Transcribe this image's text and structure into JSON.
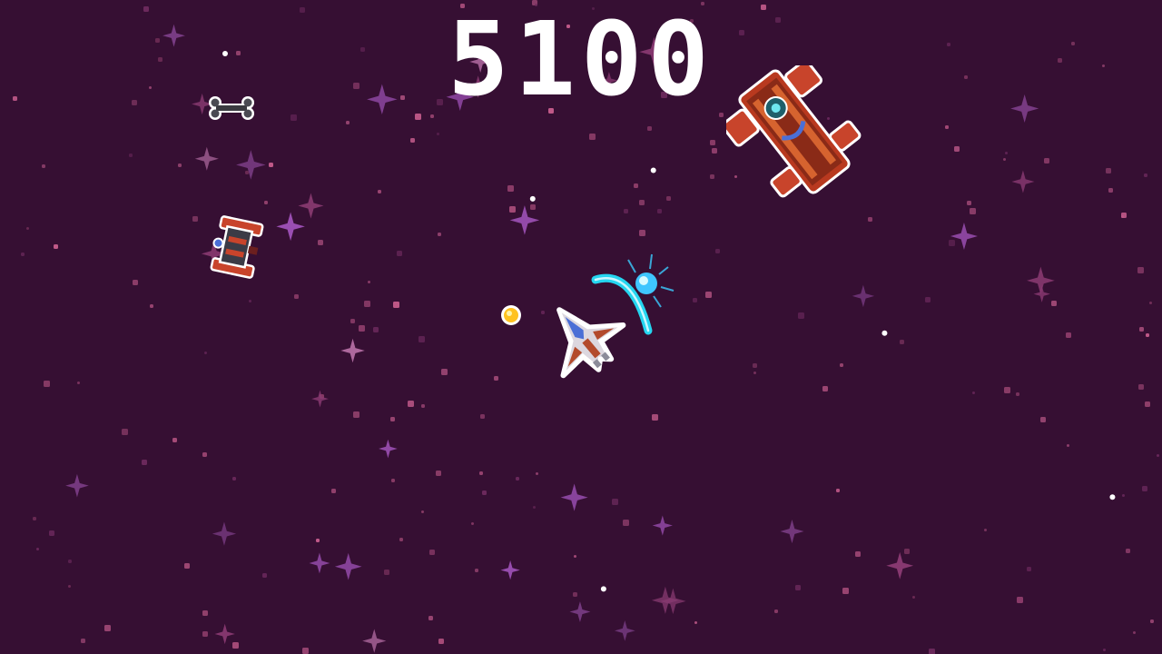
{
  "hud": {
    "score": "5100"
  },
  "colors": {
    "background": "#360f33",
    "star_dot": "#a24a78",
    "star_sparkle": "#7b3d86",
    "player_hull": "#e8e4ea",
    "player_accent": "#b34a2c",
    "enemy_hull": "#c8442b",
    "enemy_dark": "#6b1f1f",
    "shield_arc": "#25d6f0",
    "enemy_bullet": "#ffc21f",
    "outline": "#ffffff"
  },
  "sprites": [
    {
      "name": "player-ship",
      "icon": "spaceship-icon"
    },
    {
      "name": "shield-arc",
      "icon": "energy-arc-icon"
    },
    {
      "name": "enemy-bullet",
      "icon": "fireball-icon"
    },
    {
      "name": "enemy-heavy-cruiser",
      "icon": "cruiser-icon"
    },
    {
      "name": "enemy-fighter",
      "icon": "fighter-icon"
    },
    {
      "name": "bone-pickup",
      "icon": "bone-icon"
    }
  ]
}
